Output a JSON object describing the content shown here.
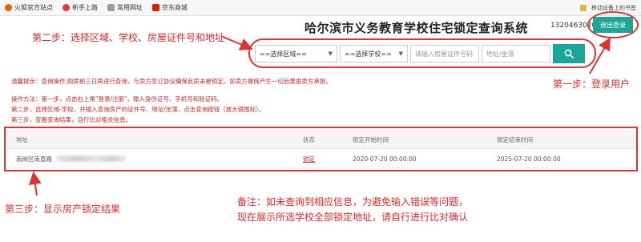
{
  "browser": {
    "bookmarks": [
      {
        "label": "火狐官方站点",
        "icon": "firefox-icon",
        "color": "#e66000"
      },
      {
        "label": "新手上路",
        "icon": "star-icon",
        "color": "#e53935"
      },
      {
        "label": "常用网址",
        "icon": "folder-icon",
        "color": "#7a7a7a"
      },
      {
        "label": "京东商城",
        "icon": "jd-icon",
        "color": "#d81e06"
      }
    ],
    "mobile_bookmarks": "移动设备上的书签"
  },
  "header": {
    "title": "哈尔滨市义务教育学校住宅锁定查询系统",
    "phone": "13204630205",
    "logout_label": "退出登录"
  },
  "search": {
    "district_select": "==选择区域==",
    "school_select": "==选择学校==",
    "cert_placeholder": "请输入房屋证件号码",
    "address_placeholder": "地址/坐落",
    "button_icon": "search-icon"
  },
  "tips": {
    "warning": "温馨提示：查询操作,购房前三日再进行查询，与卖方签订协议确保此房未被锁定。如卖方做假产生一切后果由卖方承担。",
    "method_1": "操作方法：第一步，点击右上角\"登录/注册\"，输入身份证号、手机号和验证码。",
    "method_2": "第二步，选择区域-学校，并输入查询房产的证件号、地址/坐落，点击查询按钮（放大镜图标）。",
    "method_3": "第三步，查看查询结果，自行比对相关信息。"
  },
  "table": {
    "columns": [
      "地址",
      "状态",
      "锁定开始时间",
      "锁定结束时间"
    ],
    "rows": [
      {
        "address": "南岗区南直路",
        "status": "锁定",
        "start": "2020-07-20 00:00:00",
        "end": "2025-07-20 00:00:00"
      }
    ]
  },
  "annotations": {
    "step1": "第一步：登录用户",
    "step2": "第二步：选择区域、学校、房屋证件号和地址",
    "step3": "第三步：显示房产锁定结果",
    "note_line1": "备注：如未查询到相应信息，为避免输入错误等问题，",
    "note_line2": "现在展示所选学校全部锁定地址，请自行进行比对确认",
    "color": "#d42d2d"
  }
}
